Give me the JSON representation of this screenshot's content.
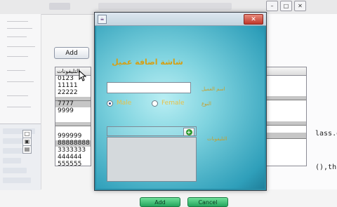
{
  "window_controls": {
    "minimize": "–",
    "maximize": "□",
    "close": "✕"
  },
  "background_app": {
    "add_button_label": "Add",
    "phones_column_header": "التليفونات",
    "phones": [
      "0123",
      "11111",
      "22222",
      "",
      "7777",
      "9999",
      "",
      "",
      "",
      "999999",
      "88888888",
      "3333333",
      "444444",
      "555555"
    ],
    "side_buttons": [
      "□",
      "▣",
      "▤"
    ],
    "code_fragments": [
      "lass.g",
      "(),th"
    ]
  },
  "dialog": {
    "icon_glyph": "☕",
    "close_glyph": "✕",
    "title": "شاشة اضافة عميل",
    "name_label": "اسم العميل",
    "name_value": "",
    "gender_label": "النوع",
    "gender_options": {
      "male": "Male",
      "female": "Female"
    },
    "selected_gender": "male",
    "add_phone_glyph": "+",
    "phones_label": "التليفونات",
    "buttons": {
      "add": "Add",
      "cancel": "Cancel"
    }
  },
  "colors": {
    "dialog_accent": "#d4a017",
    "dialog_teal": "#2b8ea7",
    "button_green": "#25a65e",
    "close_red": "#c0392b"
  }
}
